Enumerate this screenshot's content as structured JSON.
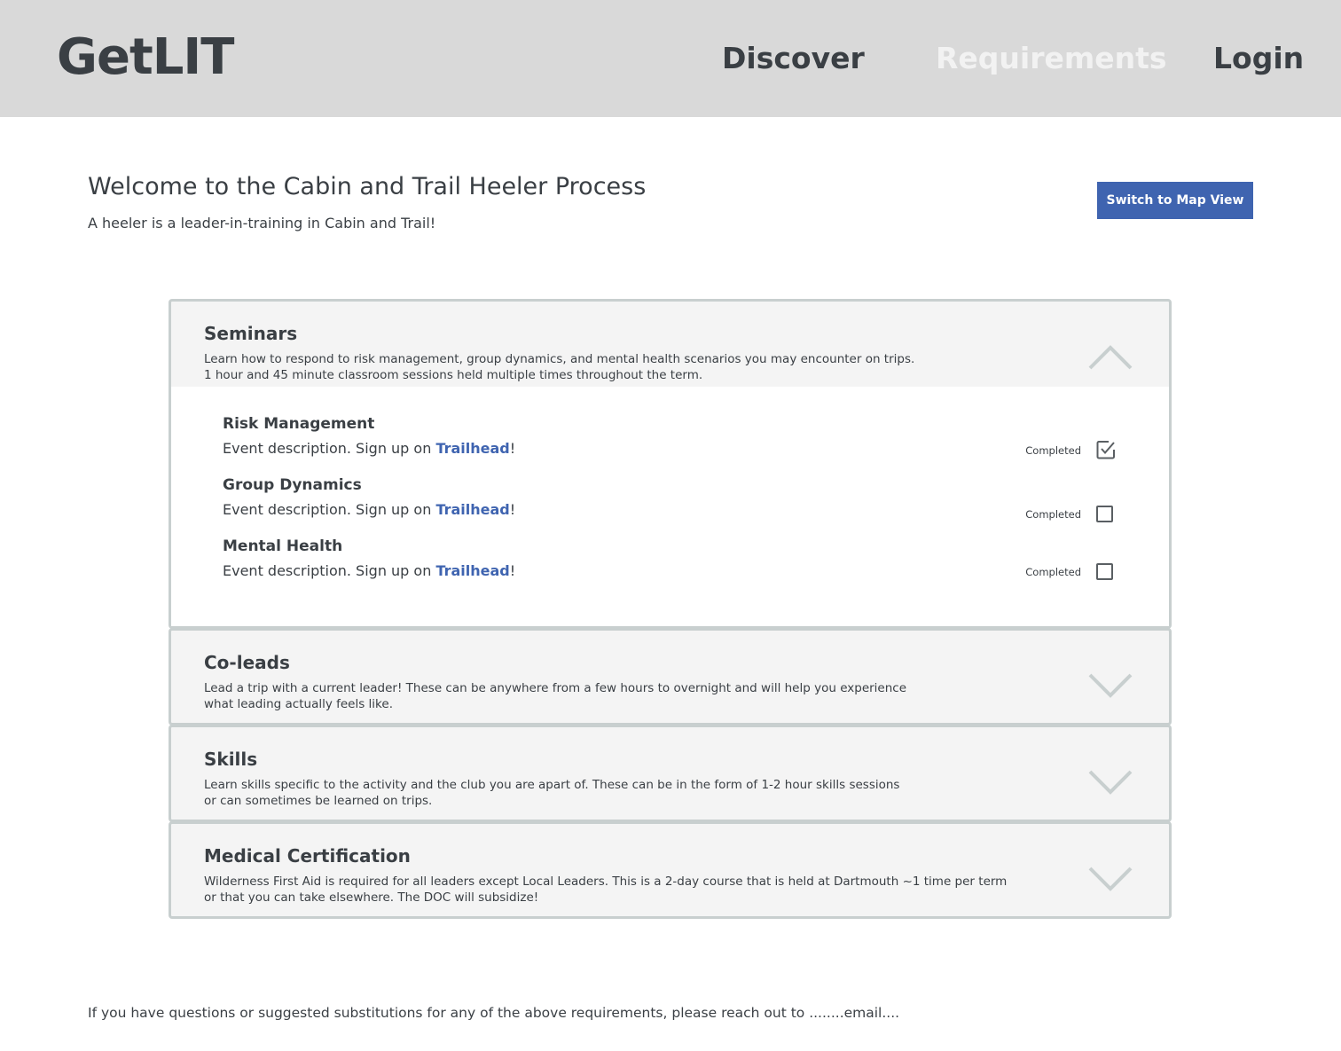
{
  "header": {
    "logo": "GetLIT",
    "nav": {
      "discover": "Discover",
      "requirements": "Requirements",
      "login": "Login"
    }
  },
  "intro": {
    "title": "Welcome to the Cabin and Trail Heeler Process",
    "subtitle": "A heeler is a leader-in-training in Cabin and Trail!",
    "map_button": "Switch to Map View"
  },
  "sections": [
    {
      "title": "Seminars",
      "desc_line1": "Learn how to respond to risk management, group dynamics, and mental health scenarios you may encounter on trips.",
      "desc_line2": "1 hour and 45 minute classroom sessions held multiple times throughout the term.",
      "expanded": true,
      "events": [
        {
          "title": "Risk Management",
          "desc_prefix": "Event description. Sign up on ",
          "link": "Trailhead",
          "desc_suffix": "!",
          "status_label": "Completed",
          "checked": true
        },
        {
          "title": "Group Dynamics",
          "desc_prefix": "Event description. Sign up on ",
          "link": "Trailhead",
          "desc_suffix": "!",
          "status_label": "Completed",
          "checked": false
        },
        {
          "title": "Mental Health",
          "desc_prefix": "Event description. Sign up on ",
          "link": "Trailhead",
          "desc_suffix": "!",
          "status_label": "Completed",
          "checked": false
        }
      ]
    },
    {
      "title": "Co-leads",
      "desc_line1": "Lead a trip with a current leader! These can be anywhere from a few hours to overnight and will help you experience",
      "desc_line2": "what leading actually feels like.",
      "expanded": false
    },
    {
      "title": "Skills",
      "desc_line1": "Learn skills specific to the activity and the club you are apart of. These can be in the form of 1-2 hour skills sessions",
      "desc_line2": "or can sometimes be learned on trips.",
      "expanded": false
    },
    {
      "title": "Medical Certification",
      "desc_line1": "Wilderness First Aid is required for all leaders except Local Leaders. This is a 2-day course that is held at Dartmouth ~1 time per term",
      "desc_line2": "or that you can take elsewhere. The DOC will subsidize!",
      "expanded": false
    }
  ],
  "footer": {
    "note": "If you have questions or suggested substitutions for any of the above requirements, please reach out to ........email...."
  },
  "colors": {
    "header_bg": "#d9d9d9",
    "accent": "#3f64b0",
    "section_bg": "#f4f4f4",
    "border": "#c8cfcf",
    "text": "#3a3f44"
  }
}
